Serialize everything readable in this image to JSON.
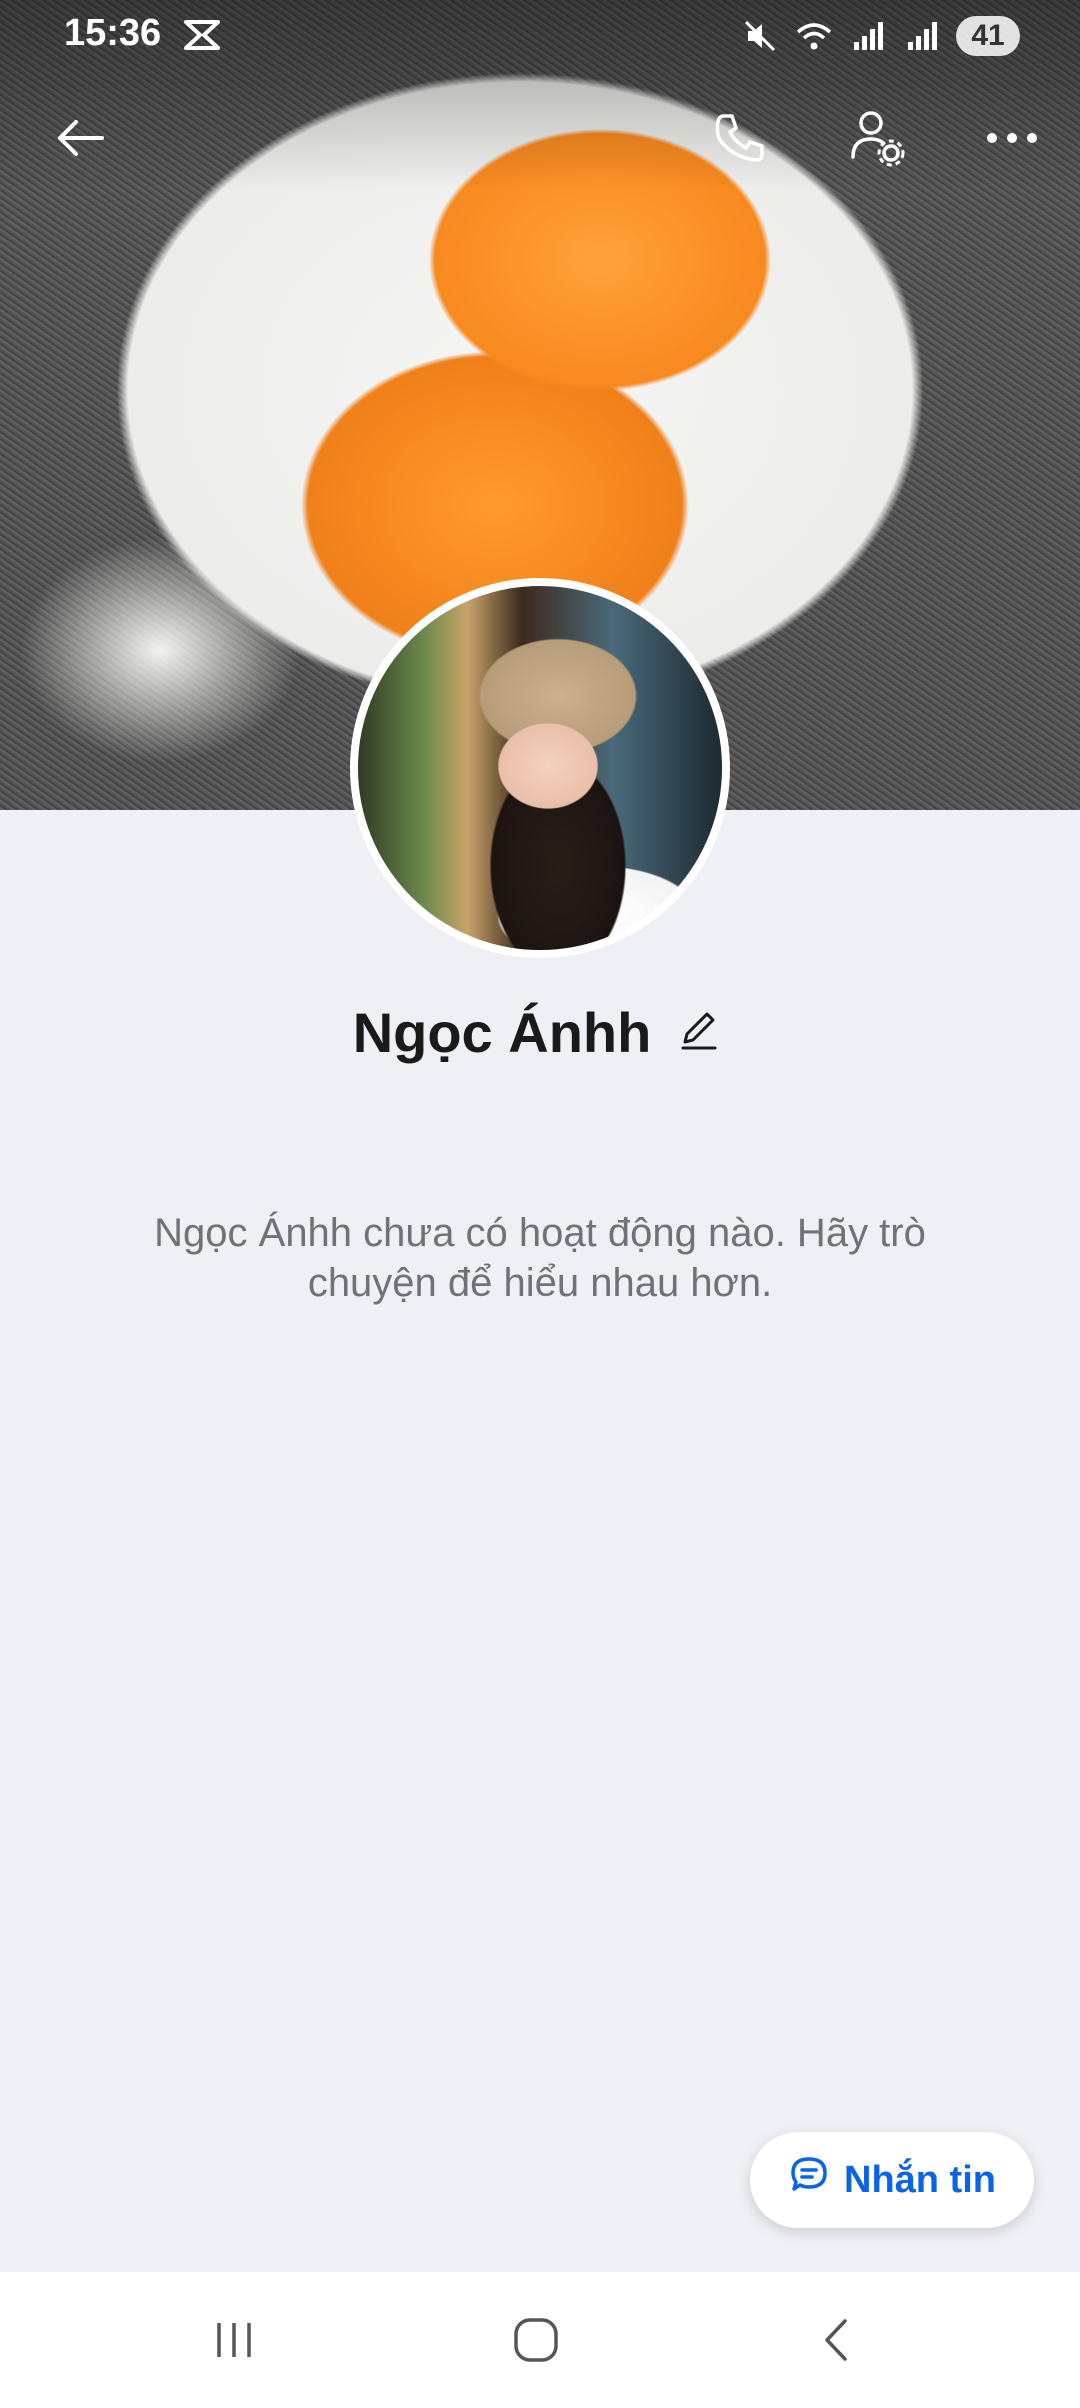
{
  "status_bar": {
    "time": "15:36",
    "battery": "41",
    "icons": [
      "capcut-icon",
      "mute-icon",
      "wifi-icon",
      "signal-icon",
      "signal-icon-2"
    ]
  },
  "header": {
    "icons": [
      "back-arrow-icon",
      "phone-icon",
      "user-settings-icon",
      "more-icon"
    ]
  },
  "profile": {
    "name": "Ngọc Ánhh",
    "empty_activity_text": "Ngọc Ánhh chưa có hoạt động nào. Hãy trò chuyện để hiểu nhau hơn."
  },
  "message_button": {
    "label": "Nhắn tin",
    "icon": "chat-bubble-icon",
    "color": "#0b63e5"
  },
  "nav_bar": {
    "icons": [
      "recents-icon",
      "home-icon",
      "back-icon"
    ]
  }
}
